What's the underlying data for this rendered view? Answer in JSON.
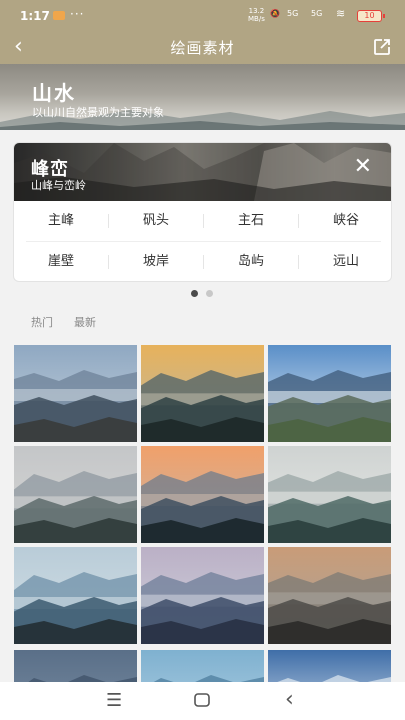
{
  "status": {
    "time": "1:17",
    "more": "···",
    "speed_top": "13.2",
    "speed_bottom": "MB/s",
    "signal1": "5G",
    "signal2": "5G",
    "battery": "10"
  },
  "header": {
    "title": "绘画素材"
  },
  "hero": {
    "title": "山水",
    "subtitle": "以山川自然景观为主要对象"
  },
  "panel": {
    "title": "峰峦",
    "subtitle": "山峰与峦岭",
    "tags": [
      "主峰",
      "矾头",
      "主石",
      "峡谷",
      "崖壁",
      "坡岸",
      "岛屿",
      "远山"
    ]
  },
  "carousel": {
    "pages": 2,
    "active": 1
  },
  "sort": {
    "hot": "热门",
    "new": "最新"
  },
  "colors": {
    "bar": "#b1a584",
    "accent_battery": "#e6403a",
    "dot_active": "#4a4a4a",
    "dot_inactive": "#c8c8c8"
  },
  "thumbnails": [
    {
      "name": "blue-valley-village",
      "sky": "#8fa8c2",
      "haze": "#c6d2dc",
      "far": "#6d8298",
      "mid": "#3f4f5e",
      "near": "#3a3e3f"
    },
    {
      "name": "sunrise-golden-haze",
      "sky": "#e7b25c",
      "haze": "#b9b6a5",
      "far": "#4e6268",
      "mid": "#2f4244",
      "near": "#1f2b2b"
    },
    {
      "name": "blue-sea-of-clouds",
      "sky": "#5a8fc8",
      "haze": "#e5eef5",
      "far": "#3e5a78",
      "mid": "#596b5a",
      "near": "#4d6444"
    },
    {
      "name": "misty-grey-hills",
      "sky": "#c4c6c8",
      "haze": "#d7d7d5",
      "far": "#8f98a0",
      "mid": "#5d6b6b",
      "near": "#34403f"
    },
    {
      "name": "orange-dawn-ridges",
      "sky": "#f0a06a",
      "haze": "#c8b6a8",
      "far": "#6f7c8c",
      "mid": "#3f5060",
      "near": "#1e2a30"
    },
    {
      "name": "pale-morning-fog",
      "sky": "#cfd3d2",
      "haze": "#e6e8e5",
      "far": "#9aa6a6",
      "mid": "#4f6a66",
      "near": "#2f4442"
    },
    {
      "name": "teal-blue-ranges",
      "sky": "#b9ccd8",
      "haze": "#d4e0e6",
      "far": "#6f90a8",
      "mid": "#3c5b70",
      "near": "#26333a"
    },
    {
      "name": "violet-dusk-peaks",
      "sky": "#bbb0c6",
      "haze": "#cfd2dc",
      "far": "#6e7d98",
      "mid": "#3e4e68",
      "near": "#2b3448"
    },
    {
      "name": "amber-city-plain",
      "sky": "#c99c78",
      "haze": "#a9a39b",
      "far": "#7c7a74",
      "mid": "#4e4c49",
      "near": "#2f2e2c"
    },
    {
      "name": "deep-blue-dusk",
      "sky": "#5a6f88",
      "haze": "#7f93a8",
      "far": "#3f5168",
      "mid": "#2d3b4e",
      "near": "#1e2835"
    },
    {
      "name": "aqua-clouds",
      "sky": "#7fb1d0",
      "haze": "#b8d4e4",
      "far": "#4d7e9e",
      "mid": "#3a5f78",
      "near": "#24404f"
    },
    {
      "name": "snowy-blue-peaks",
      "sky": "#3f6ea8",
      "haze": "#eef3f7",
      "far": "#d9e4ee",
      "mid": "#9db3c6",
      "near": "#5b7a94"
    }
  ]
}
